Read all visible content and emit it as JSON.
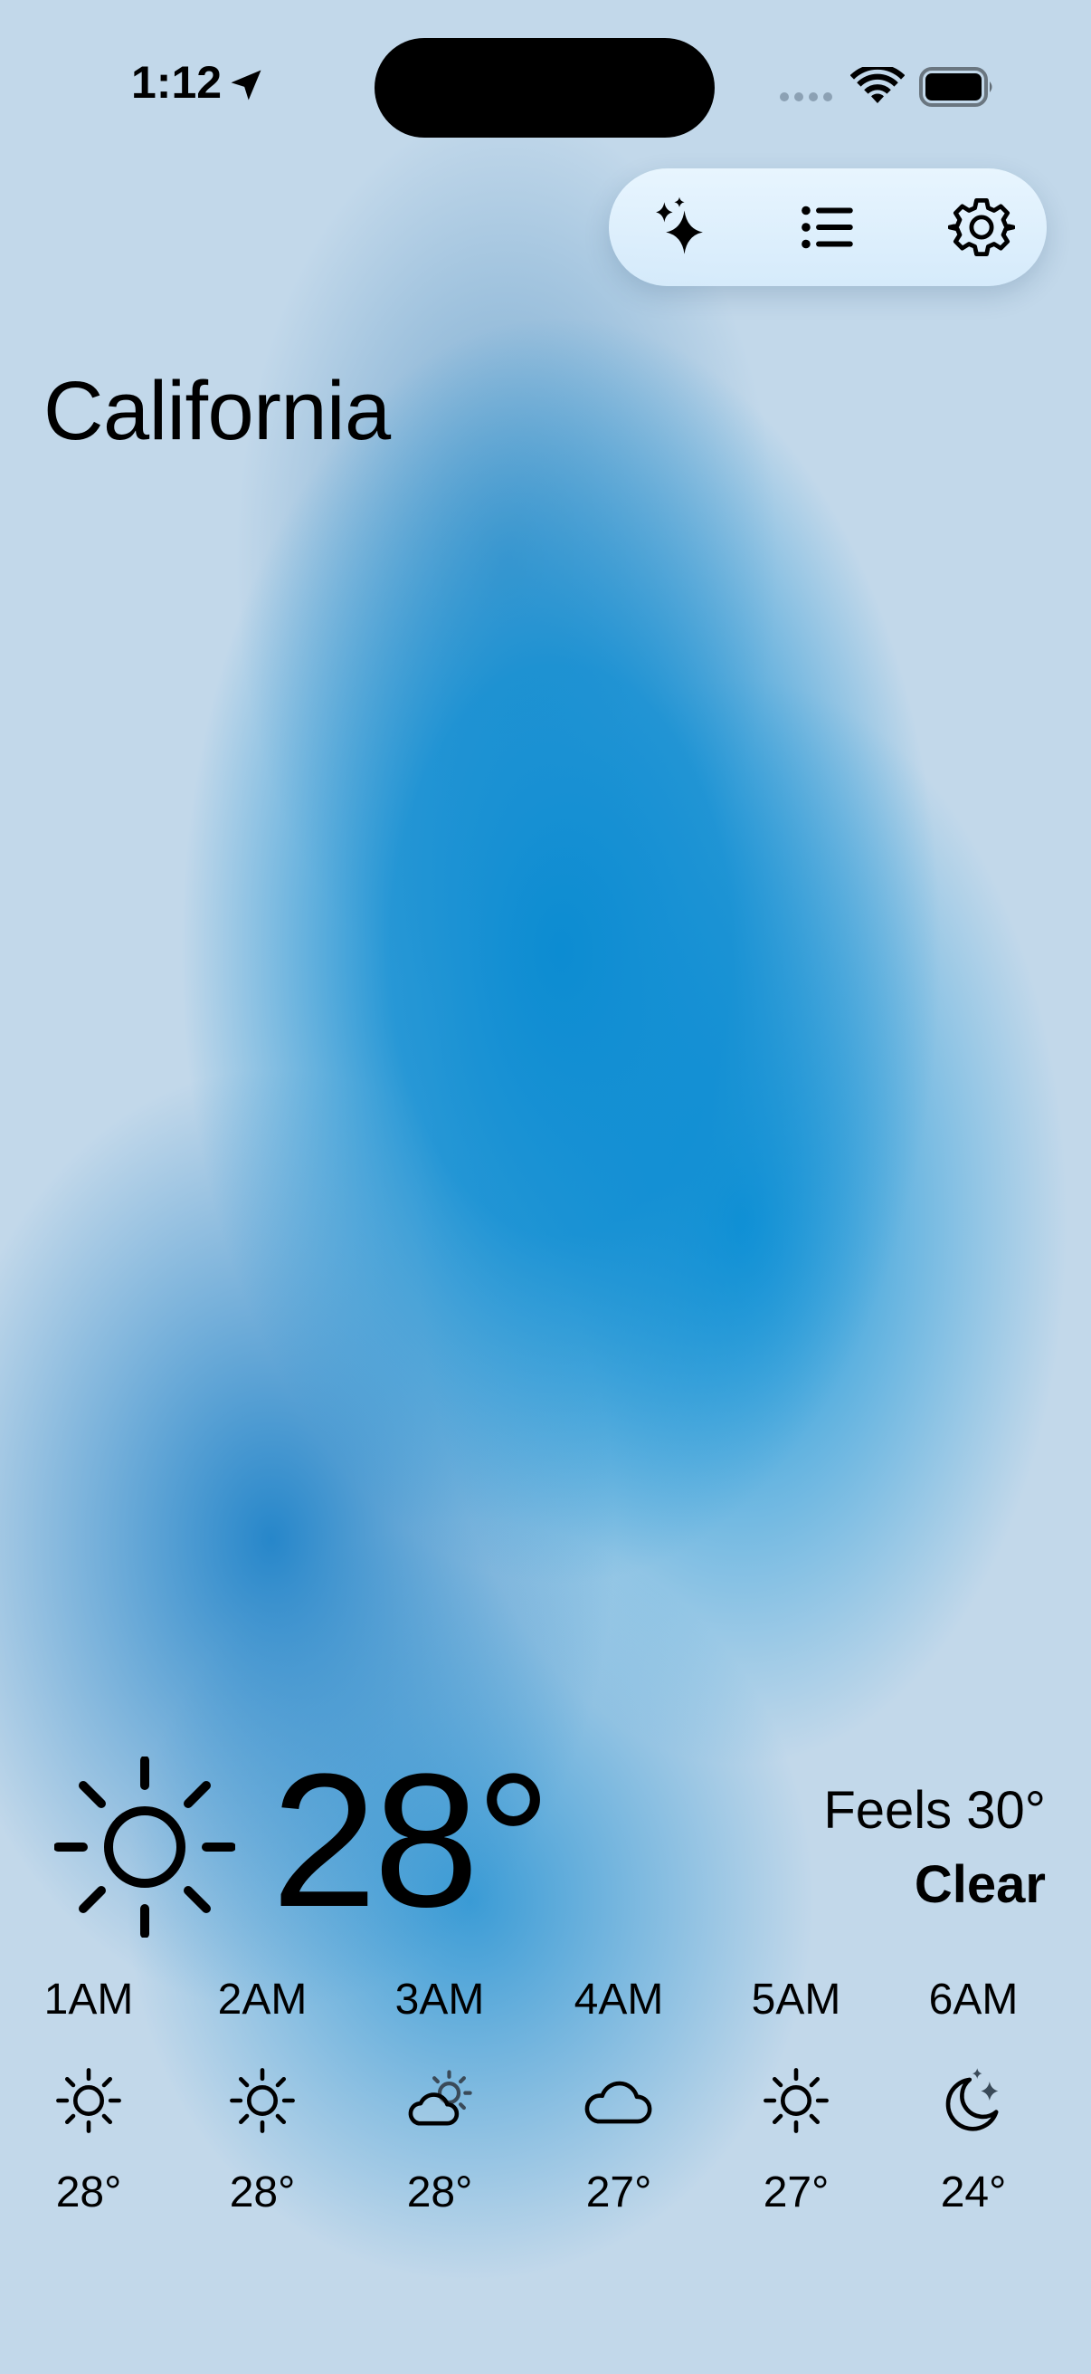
{
  "status_bar": {
    "time": "1:12",
    "icons": [
      "location-arrow-icon",
      "cellular-signal-icon",
      "wifi-icon",
      "battery-icon"
    ]
  },
  "toolbar": {
    "buttons": [
      {
        "icon": "sparkles-icon"
      },
      {
        "icon": "list-icon"
      },
      {
        "icon": "gear-icon"
      }
    ]
  },
  "location": {
    "name": "California"
  },
  "current": {
    "icon": "sun-icon",
    "temperature": "28°",
    "feels_like": "Feels 30°",
    "condition": "Clear"
  },
  "hourly": [
    {
      "time": "1AM",
      "icon": "sun-icon",
      "temp": "28°"
    },
    {
      "time": "2AM",
      "icon": "sun-icon",
      "temp": "28°"
    },
    {
      "time": "3AM",
      "icon": "cloud-sun-icon",
      "temp": "28°"
    },
    {
      "time": "4AM",
      "icon": "cloud-icon",
      "temp": "27°"
    },
    {
      "time": "5AM",
      "icon": "sun-icon",
      "temp": "27°"
    },
    {
      "time": "6AM",
      "icon": "moon-stars-icon",
      "temp": "24°"
    }
  ],
  "colors": {
    "background": "#c2d8ea",
    "accent_blue": "#0c8cd2",
    "toolbar_bg": "#e2f2fd"
  }
}
